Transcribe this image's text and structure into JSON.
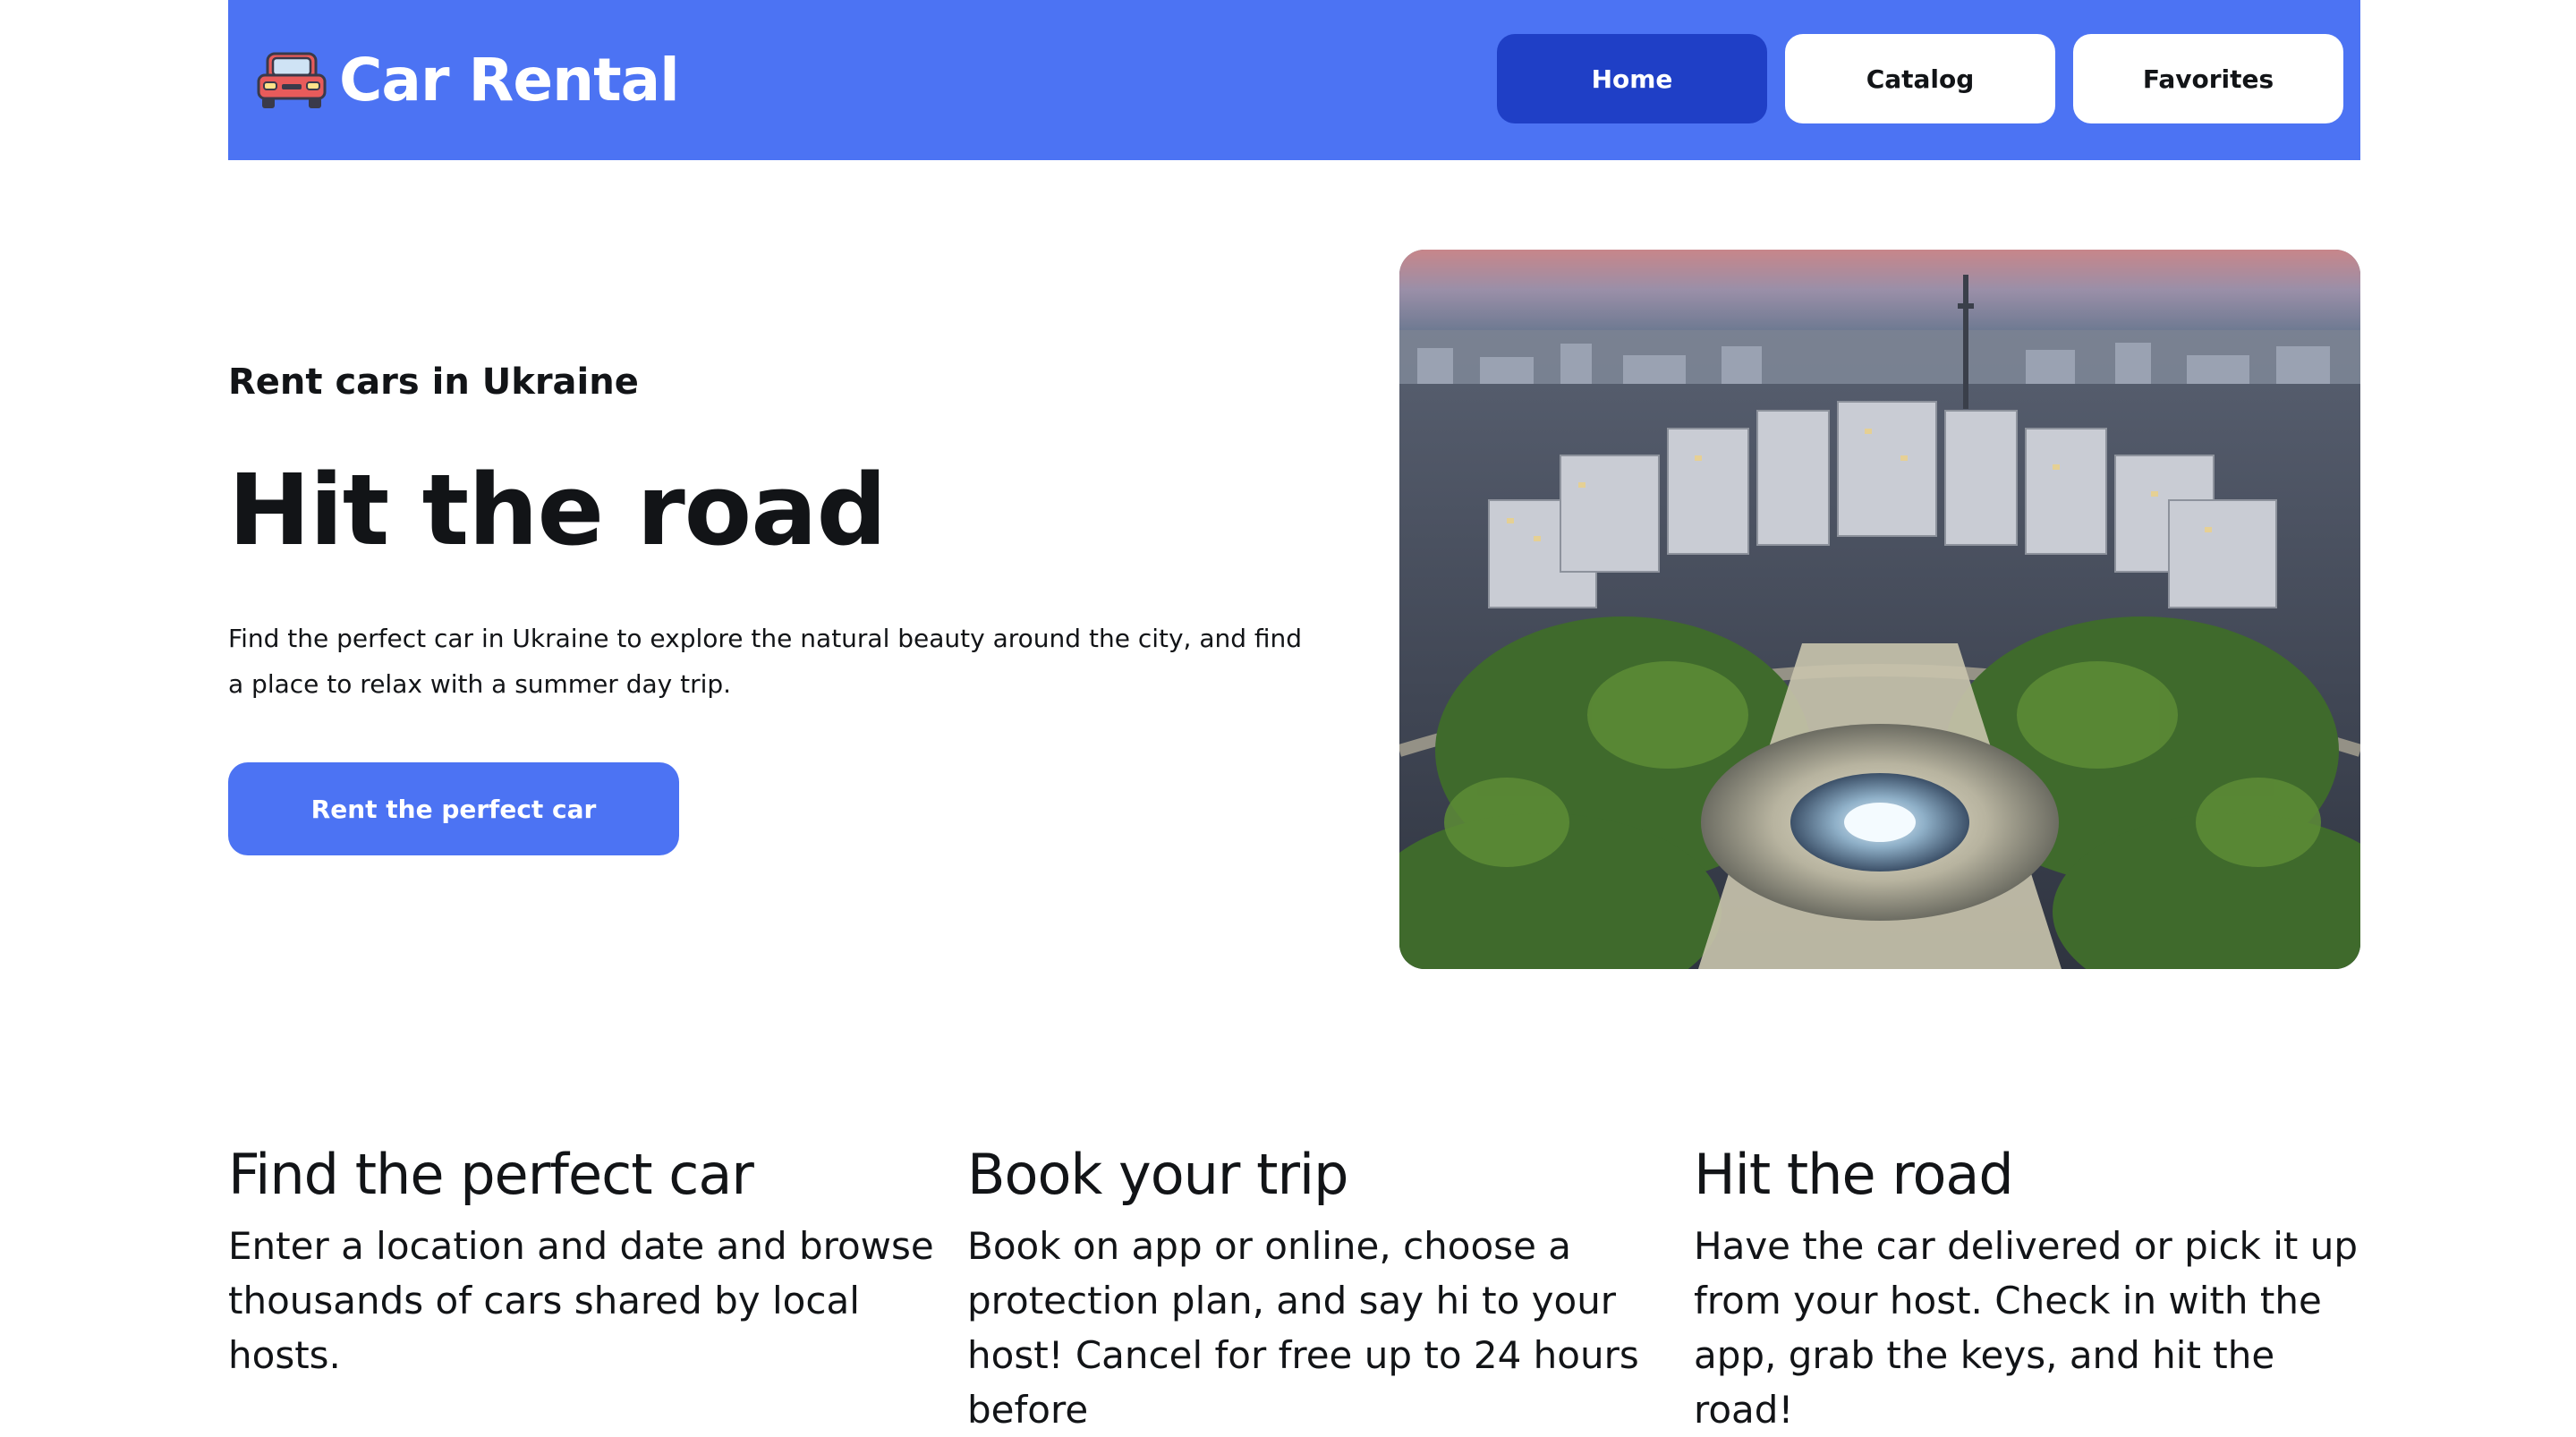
{
  "header": {
    "logo_icon": "car-icon",
    "logo_text": "Car Rental",
    "nav": {
      "home": "Home",
      "catalog": "Catalog",
      "favorites": "Favorites"
    },
    "colors": {
      "header_bg": "#4c73f3",
      "active_nav_bg": "#1f3fc6"
    }
  },
  "hero": {
    "subtitle": "Rent cars in Ukraine",
    "title": "Hit the road",
    "description": "Find the perfect car in Ukraine to explore the natural beauty around the city, and find a place to relax with a summer day trip.",
    "cta_label": "Rent the perfect car",
    "image_alt": ""
  },
  "features": [
    {
      "title": "Find the perfect car",
      "text": "Enter a location and date and browse thousands of cars shared by local hosts."
    },
    {
      "title": "Book your trip",
      "text": "Book on app or online, choose a protection plan, and say hi to your host! Cancel for free up to 24 hours before"
    },
    {
      "title": "Hit the road",
      "text": "Have the car delivered or pick it up from your host. Check in with the app, grab the keys, and hit the road!"
    }
  ]
}
